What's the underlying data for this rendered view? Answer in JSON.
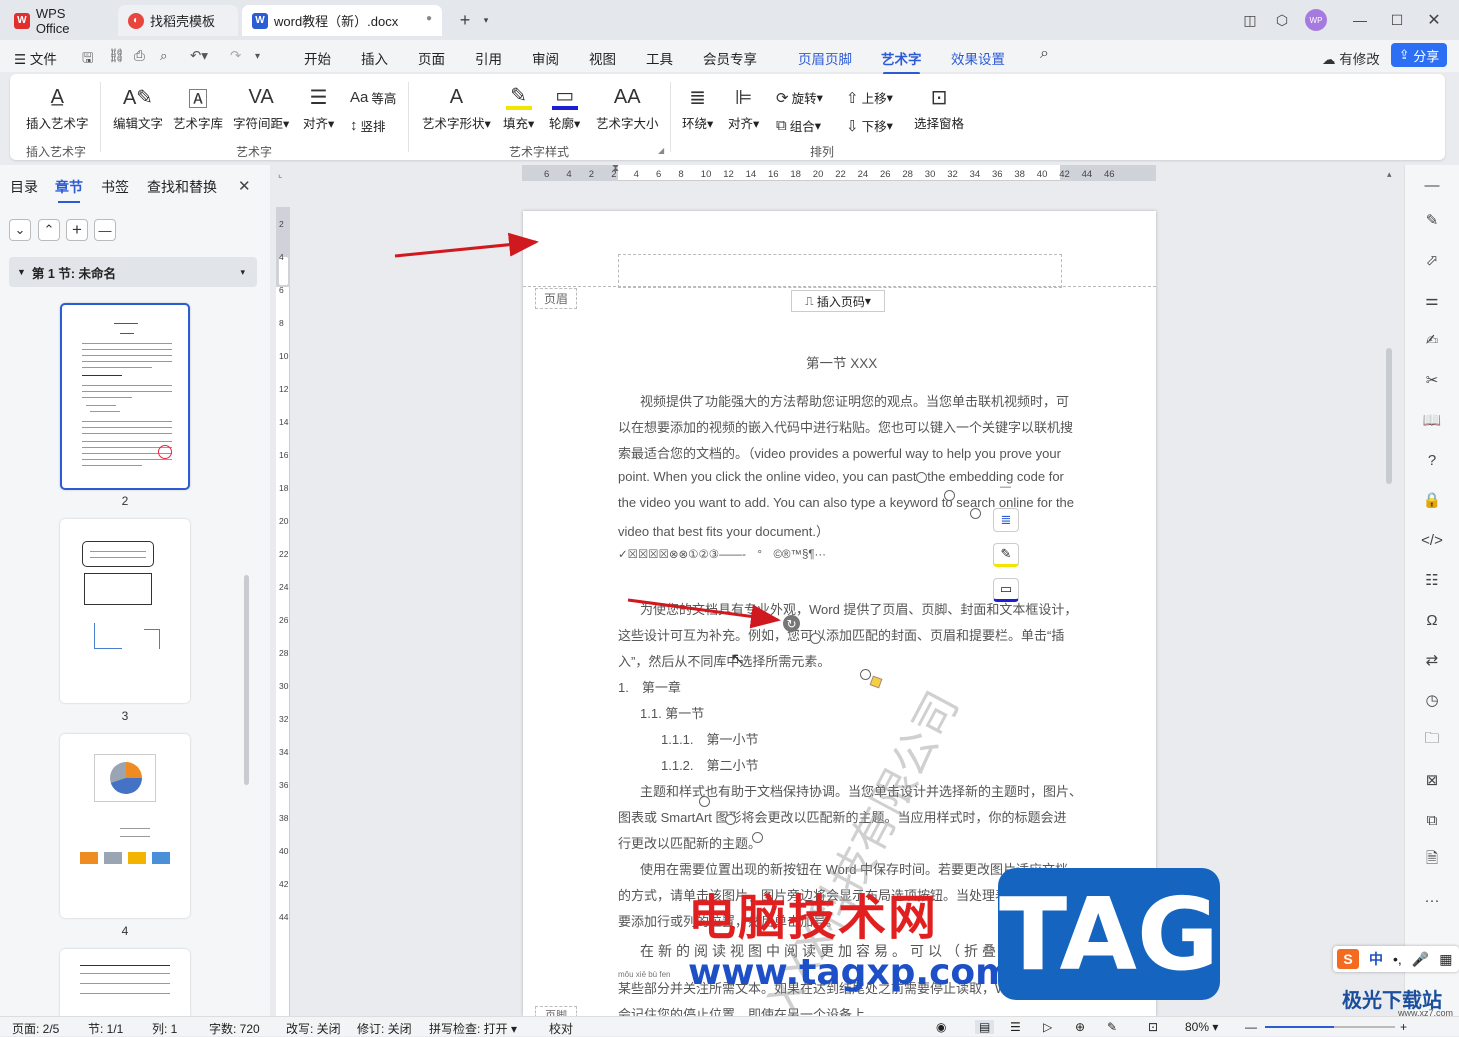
{
  "tabs": {
    "wps": "WPS Office",
    "template": "找稻壳模板",
    "doc": "word教程（新）.docx"
  },
  "menu": {
    "file": "文件",
    "items": [
      "开始",
      "插入",
      "页面",
      "引用",
      "审阅",
      "视图",
      "工具",
      "会员专享"
    ],
    "context": [
      "页眉页脚",
      "艺术字",
      "效果设置"
    ],
    "edits": "有修改",
    "share": "分享"
  },
  "ribbon": {
    "insert_art": "插入艺术字",
    "edit_text": "编辑文字",
    "art_lib": "艺术字库",
    "char_spacing": "字符间距",
    "align": "对齐",
    "equal_height": "等高",
    "vertical": "竖排",
    "art_shape": "艺术字形状",
    "fill": "填充",
    "outline": "轮廓",
    "art_size": "艺术字大小",
    "wrap": "环绕",
    "align2": "对齐",
    "rotate": "旋转",
    "group": "组合",
    "bring_up": "上移",
    "send_down": "下移",
    "select_pane": "选择窗格",
    "groups": [
      "插入艺术字",
      "艺术字",
      "艺术字样式",
      "排列"
    ]
  },
  "leftpane": {
    "tabs": [
      "目录",
      "章节",
      "书签",
      "查找和替换"
    ],
    "section": "第 1 节: 未命名",
    "pages": [
      "2",
      "3",
      "4"
    ]
  },
  "ruler": {
    "h": [
      "6",
      "4",
      "2",
      "2",
      "4",
      "6",
      "8",
      "10",
      "12",
      "14",
      "16",
      "18",
      "20",
      "22",
      "24",
      "26",
      "28",
      "30",
      "32",
      "34",
      "36",
      "38",
      "40",
      "42",
      "44",
      "46"
    ],
    "v": [
      "2",
      "4",
      "6",
      "8",
      "10",
      "12",
      "14",
      "16",
      "18",
      "20",
      "22",
      "24",
      "26",
      "28",
      "30",
      "32",
      "34",
      "36",
      "38",
      "40",
      "42",
      "44"
    ]
  },
  "document": {
    "header_label": "页眉",
    "insert_page_num": "插入页码",
    "footer_label": "页脚",
    "heading": "第一节 XXX",
    "lines": [
      "视频提供了功能强大的方法帮助您证明您的观点。当您单击联机视频时，可",
      "以在想要添加的视频的嵌入代码中进行粘贴。您也可以键入一个关键字以联机搜",
      "索最适合您的文档的。（video provides a powerful way to help you prove your",
      "point. When you click the online video, you can paste the embedding code for",
      "the video you want to add. You can also type a keyword to search online for the",
      "video that best fits your document.）",
      "✓☒☒☒☒⊗⊗①②③——-　°　©®™§¶···",
      "为使您的文档具有专业外观，Word 提供了页眉、页脚、封面和文本框设计，",
      "这些设计可互为补充。例如，您可以添加匹配的封面、页眉和提要栏。单击“插",
      "入”，然后从不同库中选择所需元素。",
      "1.　第一章",
      "1.1. 第一节",
      "1.1.1.　第一小节",
      "1.1.2.　第二小节",
      "主题和样式也有助于文档保持协调。当您单击设计并选择新的主题时，图片、",
      "图表或 SmartArt 图形将会更改以匹配新的主题。当应用样式时，你的标题会进",
      "行更改以匹配新的主题。",
      "使用在需要位置出现的新按钮在 Word 中保存时间。若要更改图片适应文档",
      "的方式，请单击该图片，图片旁边将会显示布局选项按钮。当处理表格时，单击",
      "要添加行或列的位置，然后单击加号。",
      "在新的阅读视图中阅读更加容易。可以（折叠）文档",
      "某些部分并关注所需文本。如果在达到结尾处之前需要停止读取，Word",
      "会记住您的停止位置，即使在另一个设备上。"
    ],
    "pinyin": "mǒu xiē bù fen",
    "watermark": "XXX科技有限公司"
  },
  "overlay": {
    "brand": "电脑技术网",
    "site": "www.tagxp.com",
    "tag": "TAG",
    "corner_site": "极光下载站",
    "corner_url": "www.xz7.com",
    "ime": "中"
  },
  "status": {
    "page": "页面: 2/5",
    "section": "节: 1/1",
    "column": "列: 1",
    "words": "字数: 720",
    "overtype": "改写: 关闭",
    "revision": "修订: 关闭",
    "spell": "拼写检查: 打开",
    "proof": "校对",
    "zoom": "80%"
  },
  "colors": {
    "accent": "#2c5bd6",
    "arrow": "#d0191f",
    "wps_red": "#e02f2f",
    "tag_blue": "#1565c0"
  }
}
